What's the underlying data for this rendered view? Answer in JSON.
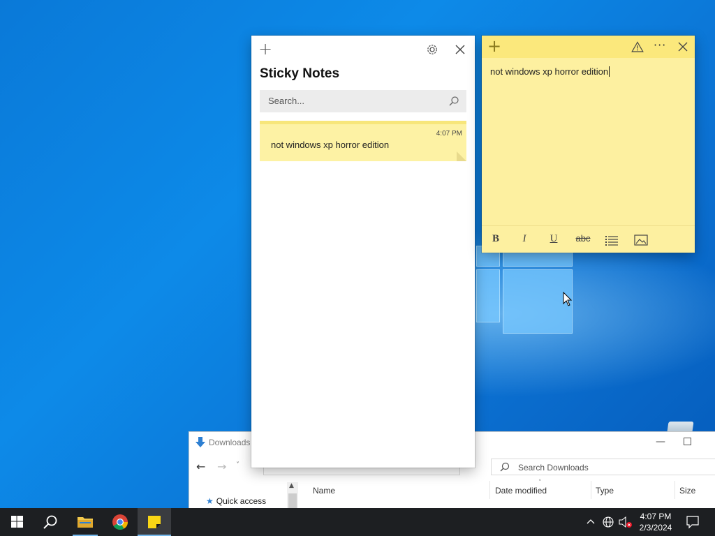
{
  "explorer": {
    "title": "Downloads",
    "search_placeholder": "Search Downloads",
    "nav_quick_access": "Quick access",
    "columns": [
      "Name",
      "Date modified",
      "Type",
      "Size"
    ]
  },
  "sticky_list": {
    "title": "Sticky Notes",
    "search_placeholder": "Search...",
    "notes": [
      {
        "time": "4:07 PM",
        "text": "not windows xp horror edition"
      }
    ]
  },
  "sticky_note": {
    "text": "not windows xp horror edition",
    "toolbar": [
      "B",
      "I",
      "U",
      "abc",
      "list",
      "image"
    ]
  },
  "taskbar": {
    "items": [
      "start",
      "search",
      "file-explorer",
      "chrome",
      "sticky-notes"
    ],
    "clock_time": "4:07 PM",
    "clock_date": "2/3/2024"
  },
  "colors": {
    "note_yellow": "#fdf0a0",
    "note_bar": "#fbe87c",
    "taskbar": "#1d1f22",
    "desktop": "#0a79d8"
  }
}
